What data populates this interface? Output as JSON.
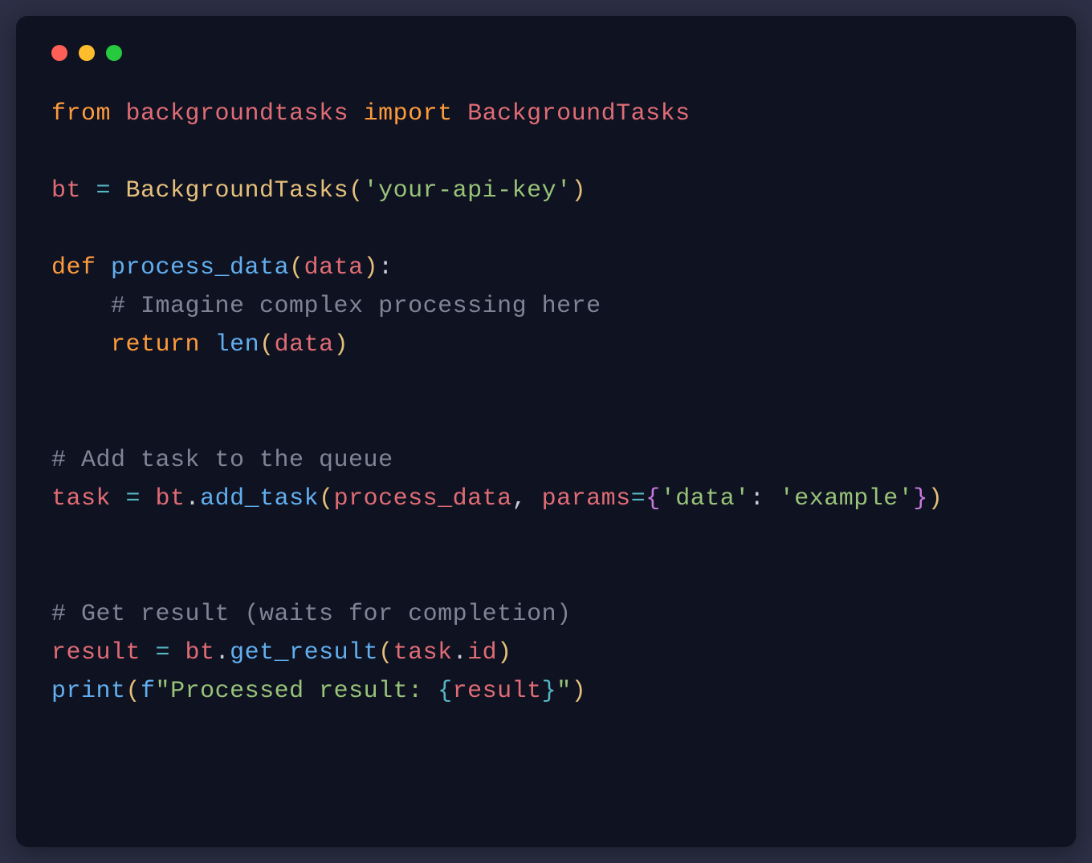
{
  "colors": {
    "background_outer": "#2c2f45",
    "background_window": "#0f1221",
    "traffic_red": "#ff5f56",
    "traffic_yellow": "#ffbd2e",
    "traffic_green": "#27c93f",
    "keyword": "#ff9b3d",
    "module": "#e06c75",
    "class": "#e5c07b",
    "function": "#61afef",
    "variable": "#e06c75",
    "operator": "#56b6c2",
    "paren_outer": "#e5c07b",
    "paren_inner": "#c678dd",
    "string": "#98c379",
    "comment": "#7f8596",
    "plain": "#c9cdd6"
  },
  "code": {
    "line1": {
      "from": "from",
      "module": "backgroundtasks",
      "import": "import",
      "class": "BackgroundTasks"
    },
    "line3": {
      "var": "bt",
      "eq": " = ",
      "class": "BackgroundTasks",
      "lpar": "(",
      "str": "'your-api-key'",
      "rpar": ")"
    },
    "line5": {
      "def": "def",
      "fn": "process_data",
      "lpar": "(",
      "param": "data",
      "rpar": ")",
      "colon": ":"
    },
    "line6": {
      "indent": "    ",
      "comment": "# Imagine complex processing here"
    },
    "line7": {
      "indent": "    ",
      "return": "return",
      "len": "len",
      "lpar": "(",
      "arg": "data",
      "rpar": ")"
    },
    "line10": {
      "comment": "# Add task to the queue"
    },
    "line11": {
      "var": "task",
      "eq": " = ",
      "obj": "bt",
      "dot": ".",
      "method": "add_task",
      "lpar": "(",
      "arg1": "process_data",
      "comma": ", ",
      "kwarg": "params",
      "eq2": "=",
      "lbrace": "{",
      "key": "'data'",
      "colon": ": ",
      "val": "'example'",
      "rbrace": "}",
      "rpar": ")"
    },
    "line14": {
      "comment": "# Get result (waits for completion)"
    },
    "line15": {
      "var": "result",
      "eq": " = ",
      "obj": "bt",
      "dot": ".",
      "method": "get_result",
      "lpar": "(",
      "arg_obj": "task",
      "dot2": ".",
      "attr": "id",
      "rpar": ")"
    },
    "line16": {
      "print": "print",
      "lpar": "(",
      "fprefix": "f",
      "quote1": "\"",
      "text": "Processed result: ",
      "lbrace": "{",
      "interp": "result",
      "rbrace": "}",
      "quote2": "\"",
      "rpar": ")"
    }
  }
}
